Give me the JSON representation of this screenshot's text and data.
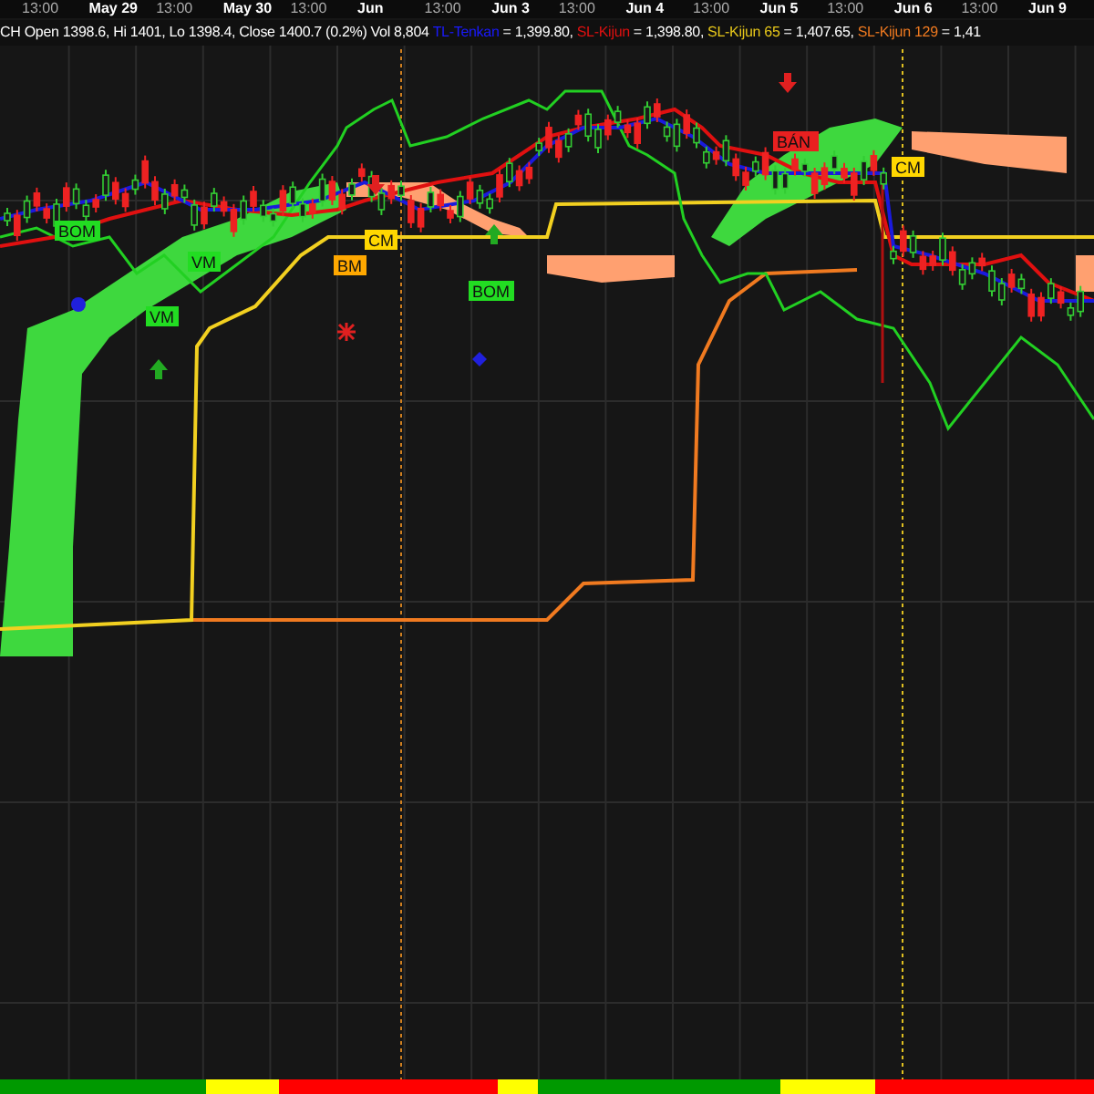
{
  "time_axis": [
    {
      "label": "13:00",
      "kind": "hour"
    },
    {
      "label": "May 29",
      "kind": "date"
    },
    {
      "label": "13:00",
      "kind": "hour"
    },
    {
      "label": "May 30",
      "kind": "date"
    },
    {
      "label": "13:00",
      "kind": "hour"
    },
    {
      "label": "Jun",
      "kind": "date"
    },
    {
      "label": "13:00",
      "kind": "hour"
    },
    {
      "label": "Jun 3",
      "kind": "date"
    },
    {
      "label": "13:00",
      "kind": "hour"
    },
    {
      "label": "Jun 4",
      "kind": "date"
    },
    {
      "label": "13:00",
      "kind": "hour"
    },
    {
      "label": "Jun 5",
      "kind": "date"
    },
    {
      "label": "13:00",
      "kind": "hour"
    },
    {
      "label": "Jun 6",
      "kind": "date"
    },
    {
      "label": "13:00",
      "kind": "hour"
    },
    {
      "label": "Jun 9",
      "kind": "date"
    }
  ],
  "header": {
    "quote": "CH Open 1398.6, Hi 1401, Lo 1398.4, Close 1400.7 (0.2%) Vol 8,804",
    "indicators": [
      {
        "name": "TL-Tenkan",
        "value": "= 1,399.80,",
        "color": "#1a1aff"
      },
      {
        "name": "SL-Kijun",
        "value": "= 1,398.80,",
        "color": "#e01010"
      },
      {
        "name": "SL-Kijun 65",
        "value": "= 1,407.65,",
        "color": "#e8c81a"
      },
      {
        "name": "SL-Kijun 129",
        "value": "= 1,41",
        "color": "#f07a20"
      }
    ]
  },
  "signals": [
    {
      "label": "BOM",
      "color": "#22dd22"
    },
    {
      "label": "VM",
      "color": "#22dd22"
    },
    {
      "label": "VM",
      "color": "#22dd22"
    },
    {
      "label": "BM",
      "color": "#ffa800"
    },
    {
      "label": "CM",
      "color": "#ffd700"
    },
    {
      "label": "BOM",
      "color": "#22dd22"
    },
    {
      "label": "BÁN",
      "color": "#e82020"
    },
    {
      "label": "CM",
      "color": "#ffd700"
    }
  ],
  "trend_bar": [
    {
      "color": "#009900"
    },
    {
      "color": "#ffff00"
    },
    {
      "color": "#ff0000"
    },
    {
      "color": "#ffff00"
    },
    {
      "color": "#009900"
    },
    {
      "color": "#ffff00"
    },
    {
      "color": "#ff0000"
    }
  ]
}
